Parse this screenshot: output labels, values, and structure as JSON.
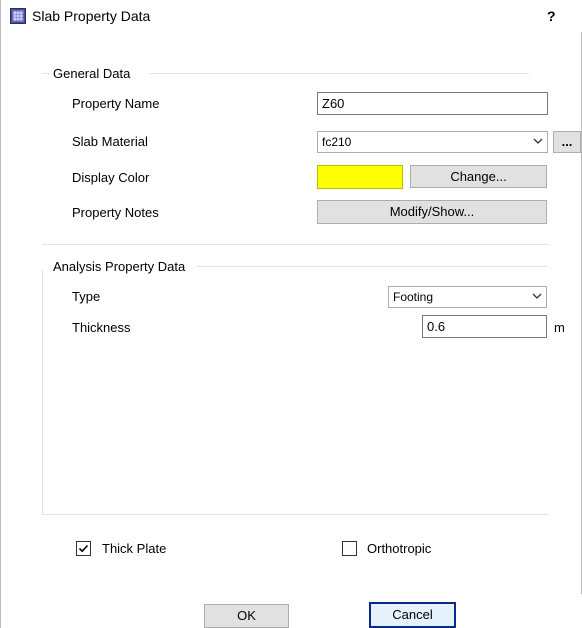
{
  "window": {
    "title": "Slab Property Data",
    "help": "?"
  },
  "general": {
    "heading": "General Data",
    "property_name_label": "Property Name",
    "property_name_value": "Z60",
    "slab_material_label": "Slab Material",
    "slab_material_value": "fc210",
    "slab_material_more": "...",
    "display_color_label": "Display Color",
    "display_color_hex": "#FFFF00",
    "change_label": "Change...",
    "property_notes_label": "Property Notes",
    "modify_show_label": "Modify/Show..."
  },
  "analysis": {
    "heading": "Analysis Property Data",
    "type_label": "Type",
    "type_value": "Footing",
    "thickness_label": "Thickness",
    "thickness_value": "0.6",
    "thickness_unit": "m"
  },
  "options": {
    "thick_plate_label": "Thick Plate",
    "thick_plate_checked": true,
    "orthotropic_label": "Orthotropic",
    "orthotropic_checked": false
  },
  "buttons": {
    "ok": "OK",
    "cancel": "Cancel"
  }
}
